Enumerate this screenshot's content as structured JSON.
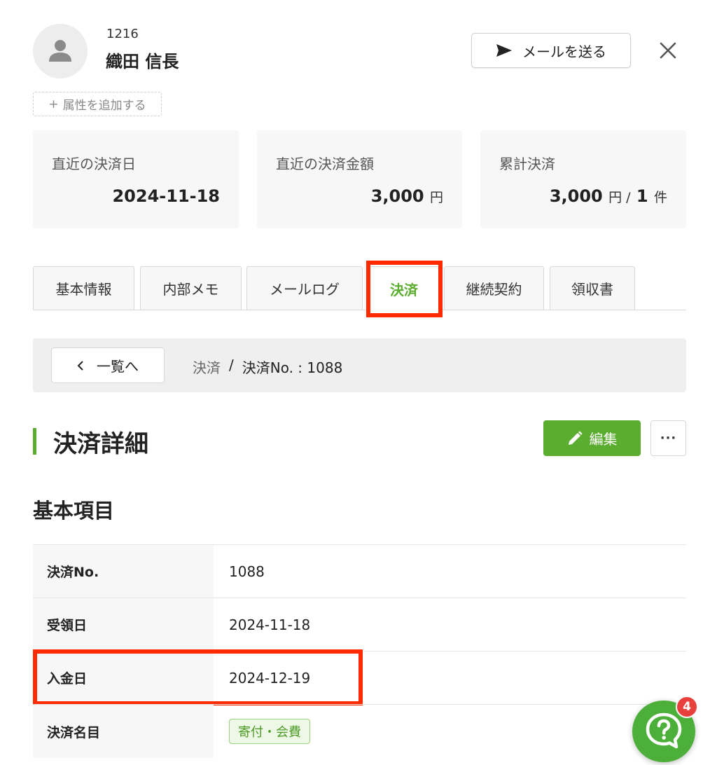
{
  "header": {
    "user_id": "1216",
    "user_name": "織田 信長",
    "add_attribute": "属性を追加する",
    "add_attribute_prefix": "+",
    "send_mail": "メールを送る"
  },
  "stats": [
    {
      "label": "直近の決済日",
      "value": "2024-11-18",
      "unit": "",
      "value2": "",
      "unit2": ""
    },
    {
      "label": "直近の決済金額",
      "value": "3,000",
      "unit": "円",
      "value2": "",
      "unit2": ""
    },
    {
      "label": "累計決済",
      "value": "3,000",
      "unit": "円 /",
      "value2": "1",
      "unit2": "件"
    }
  ],
  "tabs": [
    {
      "label": "基本情報",
      "active": false
    },
    {
      "label": "内部メモ",
      "active": false
    },
    {
      "label": "メールログ",
      "active": false
    },
    {
      "label": "決済",
      "active": true
    },
    {
      "label": "継続契約",
      "active": false
    },
    {
      "label": "領収書",
      "active": false
    }
  ],
  "breadcrumb": {
    "back_label": "一覧へ",
    "items": [
      "決済",
      "/",
      "決済No. : 1088"
    ]
  },
  "section": {
    "title": "決済詳細",
    "edit_label": "編集",
    "more_label": "···"
  },
  "basic": {
    "title": "基本項目",
    "rows": [
      {
        "key": "決済No.",
        "value": "1088"
      },
      {
        "key": "受領日",
        "value": "2024-11-18"
      },
      {
        "key": "入金日",
        "value": "2024-12-19"
      },
      {
        "key": "決済名目",
        "value": "寄付・会費"
      }
    ]
  },
  "help": {
    "badge_count": "4"
  },
  "colors": {
    "accent": "#5aad2e",
    "highlight": "#ff2a00",
    "badge": "#e8413d"
  }
}
